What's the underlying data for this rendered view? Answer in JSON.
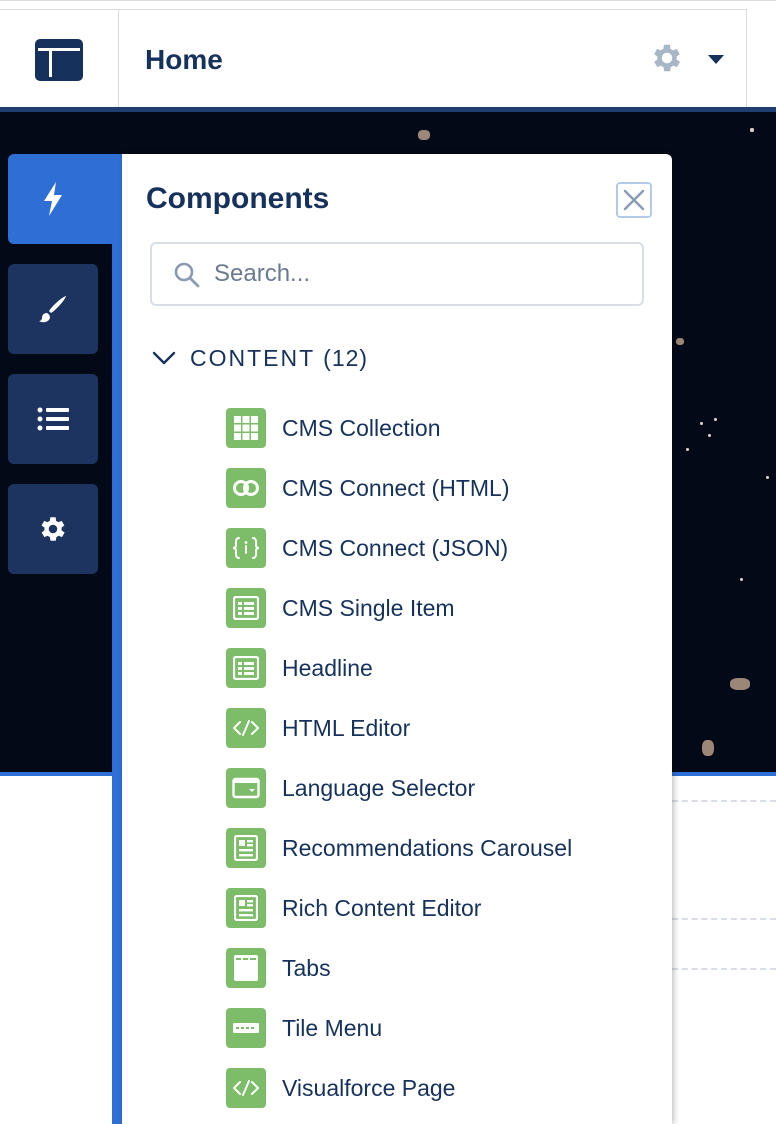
{
  "header": {
    "page_title": "Home"
  },
  "panel": {
    "title": "Components",
    "search": {
      "placeholder": "Search...",
      "value": ""
    },
    "section": {
      "label": "CONTENT",
      "count": "(12)",
      "items": [
        {
          "label": "CMS Collection",
          "icon": "grid-icon"
        },
        {
          "label": "CMS Connect (HTML)",
          "icon": "link-rings-icon"
        },
        {
          "label": "CMS Connect (JSON)",
          "icon": "json-braces-icon"
        },
        {
          "label": "CMS Single Item",
          "icon": "article-icon"
        },
        {
          "label": "Headline",
          "icon": "article-icon"
        },
        {
          "label": "HTML Editor",
          "icon": "code-icon"
        },
        {
          "label": "Language Selector",
          "icon": "dropdown-icon"
        },
        {
          "label": "Recommendations Carousel",
          "icon": "document-icon"
        },
        {
          "label": "Rich Content Editor",
          "icon": "document-icon"
        },
        {
          "label": "Tabs",
          "icon": "tabs-icon"
        },
        {
          "label": "Tile Menu",
          "icon": "tile-menu-icon"
        },
        {
          "label": "Visualforce Page",
          "icon": "code-icon"
        }
      ]
    }
  },
  "colors": {
    "rail_active": "#2e6fd6",
    "rail_button": "#1d3461",
    "component_icon": "#7dbd6a",
    "text_primary": "#16325c"
  }
}
